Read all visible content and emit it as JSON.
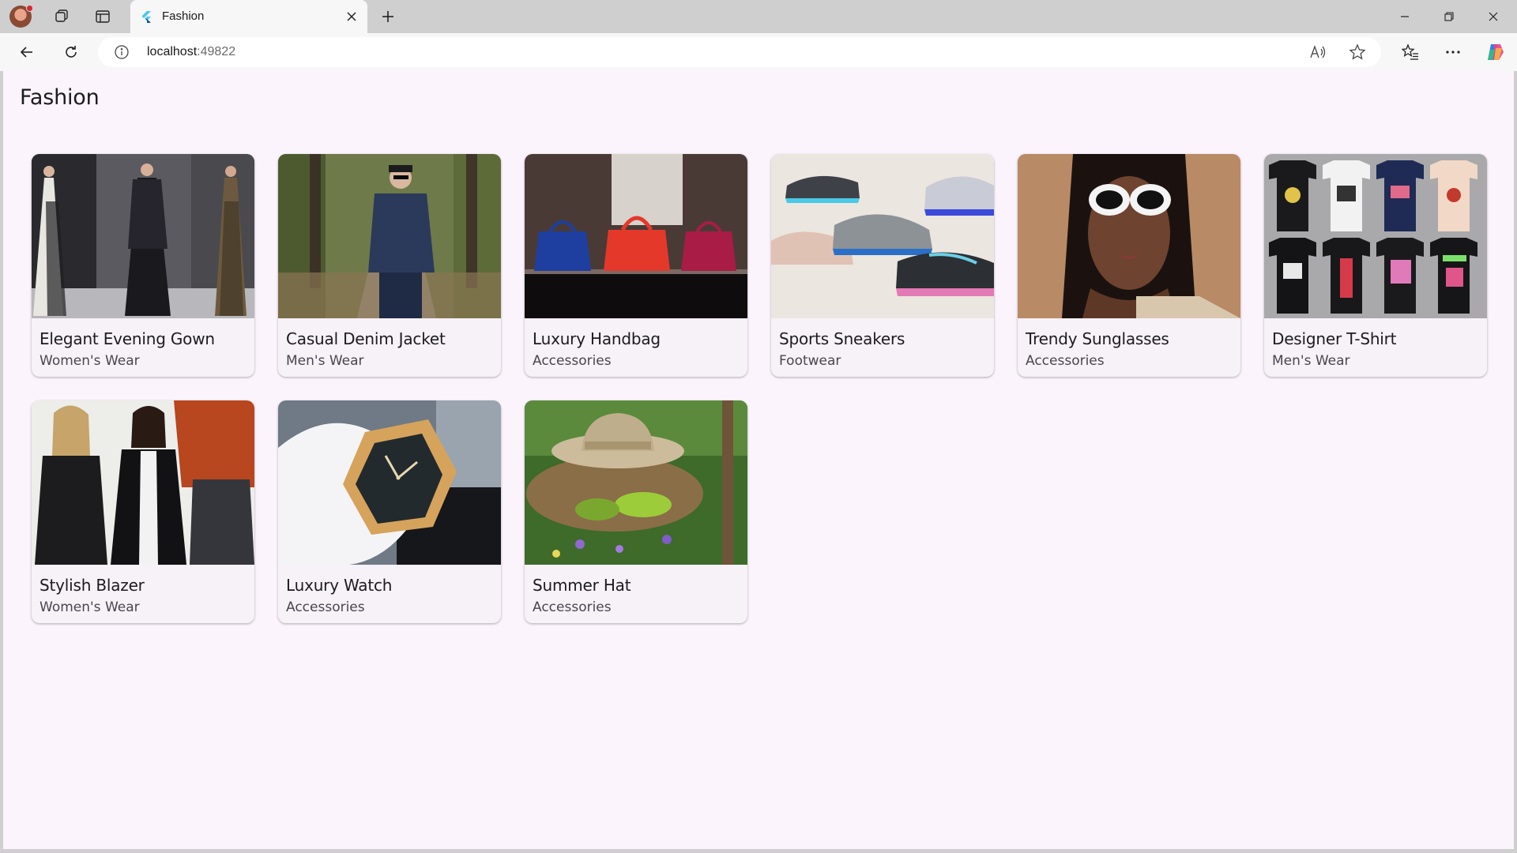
{
  "browser": {
    "tab_title": "Fashion",
    "url_host": "localhost",
    "url_port": ":49822"
  },
  "page": {
    "title": "Fashion"
  },
  "products": [
    {
      "name": "Elegant Evening Gown",
      "category": "Women's Wear",
      "image": "runway-gowns"
    },
    {
      "name": "Casual Denim Jacket",
      "category": "Men's Wear",
      "image": "man-denim-park"
    },
    {
      "name": "Luxury Handbag",
      "category": "Accessories",
      "image": "handbags-shelf"
    },
    {
      "name": "Sports Sneakers",
      "category": "Footwear",
      "image": "running-shoes"
    },
    {
      "name": "Trendy Sunglasses",
      "category": "Accessories",
      "image": "woman-white-sunglasses"
    },
    {
      "name": "Designer T-Shirt",
      "category": "Men's Wear",
      "image": "printed-tshirts"
    },
    {
      "name": "Stylish Blazer",
      "category": "Women's Wear",
      "image": "women-blazers"
    },
    {
      "name": "Luxury Watch",
      "category": "Accessories",
      "image": "gold-watch"
    },
    {
      "name": "Summer Hat",
      "category": "Accessories",
      "image": "straw-hat-garden"
    }
  ],
  "icons": {
    "back": "arrow-left-icon",
    "reload": "reload-icon",
    "info": "info-icon",
    "read_aloud": "read-aloud-icon",
    "favorite": "star-icon",
    "favorites": "favorites-icon",
    "more": "more-icon",
    "copilot": "copilot-icon"
  }
}
